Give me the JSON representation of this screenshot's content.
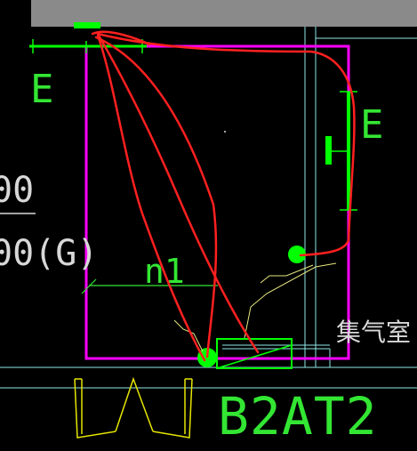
{
  "labels": {
    "e_left": "E",
    "e_right": "E",
    "n1": "n1",
    "frac_top": "00",
    "frac_bottom": "00(G)",
    "jiqishi": "集气室",
    "b2at2": "B2AT2"
  },
  "colors": {
    "background": "#000000",
    "grey_bar": "#8a8a8a",
    "magenta_box": "#ff00ff",
    "green": "#00ff00",
    "cyan_lines": "#8fe8e8",
    "light_green_text": "#33e633",
    "yellow": "#e6e600",
    "red_markup": "#ff2020",
    "white_text": "#d8d8d8"
  }
}
